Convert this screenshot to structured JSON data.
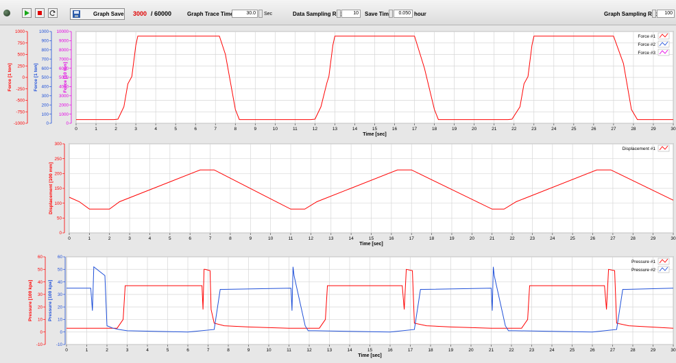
{
  "toolbar": {
    "graph_save_label": "Graph Save",
    "count_current": "3000",
    "count_total": "/ 60000",
    "trace_time_label": "Graph Trace Time",
    "trace_time_value": "30.0",
    "trace_time_unit": "Sec",
    "data_rate_label": "Data Sampling Rate",
    "data_rate_value": "10",
    "save_time_label": "Save Time",
    "save_time_value": "0.050",
    "save_time_unit": "hour",
    "graph_rate_label": "Graph Sampling Rate",
    "graph_rate_value": "100",
    "icons": [
      "record-led-icon",
      "play-icon",
      "stop-icon",
      "reset-icon",
      "graph-save-icon"
    ]
  },
  "colors": {
    "red": "#ff0000",
    "blue": "#1e4fd8",
    "magenta": "#e400e4",
    "grid": "#d6d6d6",
    "plot_bg": "#ffffff"
  },
  "chart_data": [
    {
      "type": "line",
      "xlabel": "Time [sec]",
      "xlim": [
        0,
        30
      ],
      "x_ticks": [
        0,
        1,
        2,
        3,
        4,
        5,
        6,
        7,
        8,
        9,
        10,
        11,
        12,
        13,
        14,
        15,
        16,
        17,
        18,
        19,
        20,
        21,
        22,
        23,
        24,
        25,
        26,
        27,
        28,
        29,
        30
      ],
      "axes": [
        {
          "label": "Force [1 ton]",
          "color": "red",
          "lim": [
            -1000,
            1000
          ],
          "ticks": [
            1000,
            750,
            500,
            250,
            0,
            -250,
            -500,
            -750,
            -1000
          ],
          "tick_labels": [
            "1000",
            "750",
            "500",
            "250",
            "0",
            "-250",
            "-500",
            "-750",
            "-1000"
          ]
        },
        {
          "label": "Force [1 ton]",
          "color": "blue",
          "lim": [
            0,
            1000
          ],
          "ticks": [
            1000,
            900,
            800,
            700,
            600,
            500,
            400,
            300,
            200,
            100,
            0
          ],
          "tick_labels": [
            "1000",
            "900",
            "800",
            "700",
            "600",
            "500",
            "400",
            "300",
            "200",
            "100",
            "0"
          ]
        },
        {
          "label": "Force [10 ton]",
          "color": "magenta",
          "lim": [
            0,
            10000
          ],
          "ticks": [
            10000,
            9000,
            8000,
            7000,
            6000,
            5000,
            4000,
            3000,
            2000,
            1000,
            0
          ],
          "tick_labels": [
            "10000",
            "9000",
            "8000",
            "7000",
            "6000",
            "5000",
            "4000",
            "3000",
            "2000",
            "1000",
            "0"
          ]
        }
      ],
      "legend": [
        "Force #1",
        "Force #2",
        "Force #3"
      ],
      "legend_placement": "top-right",
      "grid": true,
      "series": [
        {
          "name": "Force #1",
          "color": "red",
          "axis": 2,
          "x": [
            0,
            1.9,
            2.1,
            2.4,
            2.6,
            2.8,
            3.0,
            3.1,
            7.2,
            7.5,
            8.0,
            8.2,
            11.8,
            12.0,
            12.3,
            12.6,
            12.7,
            12.9,
            13.0,
            17.0,
            17.5,
            18.0,
            18.2,
            21.7,
            21.9,
            22.3,
            22.5,
            22.7,
            22.9,
            23.0,
            27.0,
            27.5,
            27.9,
            28.2,
            30
          ],
          "y": [
            400,
            400,
            450,
            1800,
            4300,
            5100,
            8500,
            9500,
            9500,
            7500,
            1500,
            400,
            400,
            450,
            1800,
            4400,
            5100,
            8500,
            9500,
            9500,
            6000,
            1500,
            400,
            400,
            450,
            1800,
            4300,
            5100,
            8500,
            9500,
            9500,
            6500,
            1500,
            400,
            400
          ]
        }
      ]
    },
    {
      "type": "line",
      "xlabel": "Time [sec]",
      "xlim": [
        0,
        30
      ],
      "x_ticks": [
        0,
        1,
        2,
        3,
        4,
        5,
        6,
        7,
        8,
        9,
        10,
        11,
        12,
        13,
        14,
        15,
        16,
        17,
        18,
        19,
        20,
        21,
        22,
        23,
        24,
        25,
        26,
        27,
        28,
        29,
        30
      ],
      "axes": [
        {
          "label": "Displacement [100 mm]",
          "color": "red",
          "lim": [
            0,
            300
          ],
          "ticks": [
            300,
            250,
            200,
            150,
            100,
            50,
            0
          ],
          "tick_labels": [
            "300",
            "250",
            "200",
            "150",
            "100",
            "50",
            "0"
          ]
        }
      ],
      "legend": [
        "Displacement #1"
      ],
      "legend_placement": "top-right",
      "grid": true,
      "series": [
        {
          "name": "Displacement #1",
          "color": "red",
          "x": [
            0,
            0.5,
            1.0,
            2.0,
            2.5,
            6.5,
            7.2,
            11.0,
            11.7,
            12.3,
            16.3,
            17.0,
            21.0,
            21.6,
            22.2,
            26.2,
            26.9,
            30
          ],
          "y": [
            120,
            105,
            80,
            80,
            105,
            212,
            212,
            80,
            80,
            105,
            212,
            212,
            80,
            80,
            105,
            212,
            212,
            110
          ]
        }
      ]
    },
    {
      "type": "line",
      "xlabel": "Time [sec]",
      "xlim": [
        0,
        30
      ],
      "x_ticks": [
        0,
        1,
        2,
        3,
        4,
        5,
        6,
        7,
        8,
        9,
        10,
        11,
        12,
        13,
        14,
        15,
        16,
        17,
        18,
        19,
        20,
        21,
        22,
        23,
        24,
        25,
        26,
        27,
        28,
        29,
        30
      ],
      "axes": [
        {
          "label": "Pressure [100 kpa]",
          "color": "red",
          "lim": [
            -10,
            60
          ],
          "ticks": [
            60,
            50,
            40,
            30,
            20,
            10,
            0,
            -10
          ],
          "tick_labels": [
            "60",
            "50",
            "40",
            "30",
            "20",
            "10",
            "0",
            "-10"
          ]
        },
        {
          "label": "Pressure [100 kpa]",
          "color": "blue",
          "lim": [
            -10,
            60
          ],
          "ticks": [
            60,
            50,
            40,
            30,
            20,
            10,
            0,
            -10
          ],
          "tick_labels": [
            "60",
            "50",
            "40",
            "30",
            "20",
            "10",
            "0",
            "-10"
          ]
        }
      ],
      "legend": [
        "Pressure #1",
        "Pressure #2"
      ],
      "legend_placement": "top-right",
      "grid": true,
      "series": [
        {
          "name": "Pressure #1",
          "color": "red",
          "axis": 0,
          "x": [
            0,
            2.5,
            2.8,
            2.9,
            6.7,
            6.75,
            6.8,
            6.85,
            7.1,
            7.15,
            7.3,
            7.8,
            9,
            11,
            12.5,
            12.8,
            12.9,
            16.6,
            16.7,
            16.8,
            17.1,
            17.2,
            17.8,
            19,
            21.0,
            22.5,
            22.8,
            22.9,
            26.6,
            26.7,
            26.8,
            27.1,
            27.2,
            27.8,
            30
          ],
          "y": [
            3,
            3,
            10,
            37,
            37,
            18,
            50,
            50,
            49,
            18,
            7,
            5,
            4,
            3,
            3,
            10,
            37,
            37,
            18,
            50,
            49,
            7,
            5,
            4,
            3,
            3,
            10,
            37,
            37,
            18,
            50,
            49,
            7,
            5,
            3
          ]
        },
        {
          "name": "Pressure #2",
          "color": "blue",
          "axis": 1,
          "x": [
            0,
            1.2,
            1.28,
            1.35,
            1.9,
            2.0,
            2.3,
            2.6,
            3.0,
            6.0,
            7.3,
            7.6,
            7.8,
            11.1,
            11.15,
            11.2,
            11.25,
            11.8,
            11.95,
            12.3,
            16.0,
            17.2,
            17.5,
            17.7,
            21.0,
            21.05,
            21.1,
            21.15,
            21.7,
            21.85,
            22.2,
            26.0,
            27.2,
            27.5,
            27.7,
            30
          ],
          "y": [
            35,
            35,
            17,
            52,
            45,
            5,
            3,
            2,
            1,
            0,
            2,
            34,
            34,
            35,
            17,
            52,
            45,
            5,
            1,
            1,
            0,
            2,
            34,
            34,
            35,
            17,
            52,
            45,
            5,
            1,
            1,
            0,
            2,
            34,
            34,
            35
          ]
        }
      ]
    }
  ]
}
